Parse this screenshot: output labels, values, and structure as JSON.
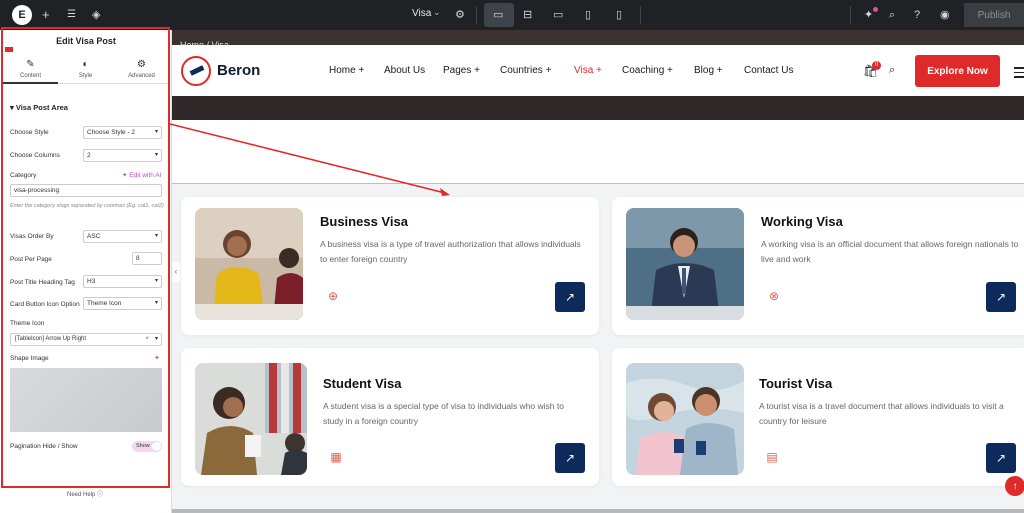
{
  "toolbar": {
    "page_name": "Visa",
    "publish_label": "Publish"
  },
  "panel": {
    "title": "Edit Visa Post",
    "tabs": [
      {
        "label": "Content",
        "icon": "pencil-icon"
      },
      {
        "label": "Style",
        "icon": "half-circle-icon"
      },
      {
        "label": "Advanced",
        "icon": "gear-icon"
      }
    ],
    "section": "Visa Post Area",
    "controls": {
      "choose_style": {
        "label": "Choose Style",
        "value": "Choose Style - 2"
      },
      "choose_columns": {
        "label": "Choose Columns",
        "value": "2"
      },
      "category": {
        "label": "Category",
        "value": "visa-processing",
        "edit_ai": "Edit with AI",
        "hint": "Enter the category slugs separated by commas (Eg. cat1, cat2)"
      },
      "order_by": {
        "label": "Visas Order By",
        "value": "ASC"
      },
      "per_page": {
        "label": "Post Per Page",
        "value": "8"
      },
      "heading_tag": {
        "label": "Post Title Heading Tag",
        "value": "H3"
      },
      "card_icon_option": {
        "label": "Card Button Icon Option",
        "value": "Theme Icon"
      },
      "theme_icon": {
        "label": "Theme Icon",
        "value": "[TableIcon] Arrow Up Right"
      },
      "shape_image": {
        "label": "Shape Image"
      },
      "pagination": {
        "label": "Pagination Hide / Show",
        "value": "Show"
      }
    },
    "need_help": "Need Help"
  },
  "site": {
    "breadcrumb": "Home / Visa",
    "brand": "Beron",
    "nav": [
      {
        "label": "Home +",
        "active": false
      },
      {
        "label": "About Us",
        "active": false
      },
      {
        "label": "Pages +",
        "active": false
      },
      {
        "label": "Countries +",
        "active": false
      },
      {
        "label": "Visa +",
        "active": true
      },
      {
        "label": "Coaching +",
        "active": false
      },
      {
        "label": "Blog +",
        "active": false
      },
      {
        "label": "Contact Us",
        "active": false
      }
    ],
    "cart_count": "0",
    "cta": "Explore Now",
    "accent": "#e02a2a",
    "navy": "#0d2a5a",
    "cards": [
      {
        "title": "Business Visa",
        "desc": "A business visa is a type of travel authorization that allows individuals to enter foreign country"
      },
      {
        "title": "Working Visa",
        "desc": "A working visa is an official document that allows foreign nationals to live and work"
      },
      {
        "title": "Student Visa",
        "desc": "A student visa is a special type of visa to individuals who wish to study in a foreign country"
      },
      {
        "title": "Tourist Visa",
        "desc": "A tourist visa is a travel document that allows individuals to visit a country for leisure"
      }
    ]
  }
}
